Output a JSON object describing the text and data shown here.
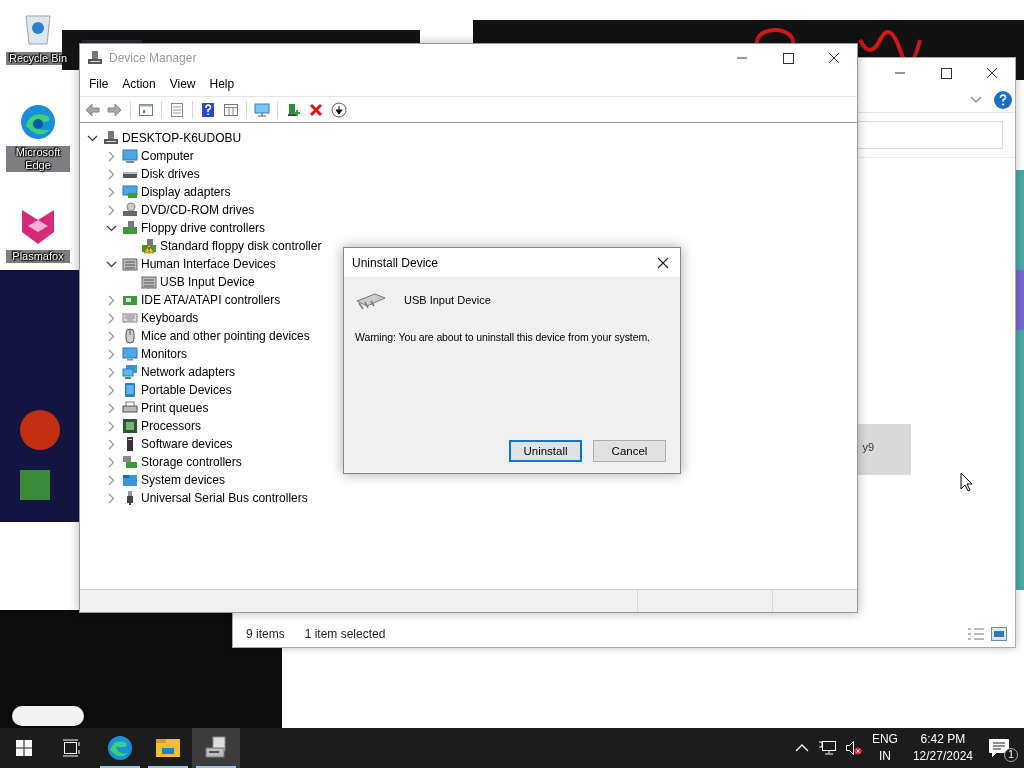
{
  "desktop": {
    "icons": [
      {
        "kind": "recycle_bin",
        "label": "Recycle Bin"
      },
      {
        "kind": "edge",
        "label": "Microsoft Edge"
      },
      {
        "kind": "plasmafox",
        "label": "Plasmafox"
      }
    ]
  },
  "explorer_window": {
    "tile_text": "y9",
    "status_bar": {
      "item_count": "9 items",
      "selection": "1 item selected"
    }
  },
  "device_manager": {
    "title": "Device Manager",
    "active": false,
    "menu": [
      "File",
      "Action",
      "View",
      "Help"
    ],
    "tree": {
      "label": "DESKTOP-K6UDOBU",
      "kind": "pc",
      "expanded": true,
      "children": [
        {
          "label": "Computer",
          "kind": "computer",
          "expanded": false
        },
        {
          "label": "Disk drives",
          "kind": "disk",
          "expanded": false
        },
        {
          "label": "Display adapters",
          "kind": "display",
          "expanded": false
        },
        {
          "label": "DVD/CD-ROM drives",
          "kind": "dvd",
          "expanded": false
        },
        {
          "label": "Floppy drive controllers",
          "kind": "floppy",
          "expanded": true,
          "children": [
            {
              "label": "Standard floppy disk controller",
              "kind": "floppy",
              "warning": true
            }
          ]
        },
        {
          "label": "Human Interface Devices",
          "kind": "hid",
          "expanded": true,
          "children": [
            {
              "label": "USB Input Device",
              "kind": "hid",
              "warning": false
            }
          ]
        },
        {
          "label": "IDE ATA/ATAPI controllers",
          "kind": "ide",
          "expanded": false
        },
        {
          "label": "Keyboards",
          "kind": "keyboard",
          "expanded": false
        },
        {
          "label": "Mice and other pointing devices",
          "kind": "mouse",
          "expanded": false
        },
        {
          "label": "Monitors",
          "kind": "monitor",
          "expanded": false
        },
        {
          "label": "Network adapters",
          "kind": "network",
          "expanded": false
        },
        {
          "label": "Portable Devices",
          "kind": "portable",
          "expanded": false
        },
        {
          "label": "Print queues",
          "kind": "printer",
          "expanded": false
        },
        {
          "label": "Processors",
          "kind": "processor",
          "expanded": false
        },
        {
          "label": "Software devices",
          "kind": "software",
          "expanded": false
        },
        {
          "label": "Storage controllers",
          "kind": "storage",
          "expanded": false
        },
        {
          "label": "System devices",
          "kind": "system",
          "expanded": false
        },
        {
          "label": "Universal Serial Bus controllers",
          "kind": "usb",
          "expanded": false
        }
      ]
    }
  },
  "dialog": {
    "title": "Uninstall Device",
    "active": true,
    "device": "USB Input Device",
    "warning": "Warning: You are about to uninstall this device from your system.",
    "buttons": [
      {
        "label": "Uninstall",
        "default": true
      },
      {
        "label": "Cancel",
        "default": false
      }
    ]
  },
  "taskbar": {
    "apps": [
      {
        "kind": "edge",
        "running": true,
        "active": false
      },
      {
        "kind": "explorer",
        "running": true,
        "active": false
      },
      {
        "kind": "device_manager",
        "running": true,
        "active": true
      }
    ],
    "language": [
      "ENG",
      "IN"
    ],
    "time": "6:42 PM",
    "date": "12/27/2024",
    "notifications": "1"
  }
}
